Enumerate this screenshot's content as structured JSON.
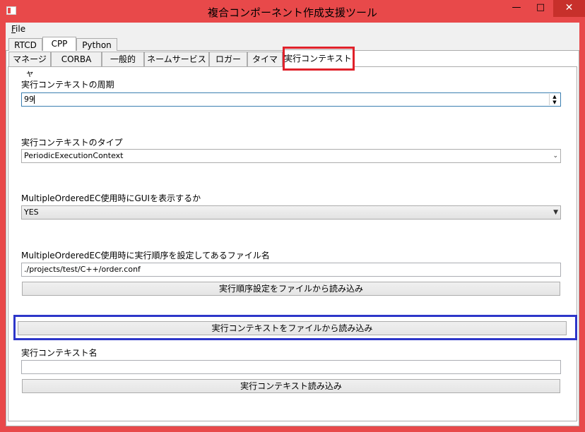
{
  "window": {
    "title": "複合コンポーネント作成支援ツール",
    "minimize_icon": "minimize-icon",
    "maximize_icon": "maximize-icon",
    "close_icon": "close-icon",
    "accent": "#e8494a"
  },
  "menu": {
    "file_prefix": "F",
    "file_rest": "ile"
  },
  "outer_tabs": [
    "RTCD",
    "CPP",
    "Python"
  ],
  "outer_tab_active": "CPP",
  "inner_tabs": [
    "マネージャ",
    "CORBA",
    "一般的",
    "ネームサービス",
    "ロガー",
    "タイマ",
    "実行コンテキスト"
  ],
  "inner_tab_active": "実行コンテキスト",
  "form": {
    "period_label": "実行コンテキストの周期",
    "period_value": "99",
    "type_label": "実行コンテキストのタイプ",
    "type_value": "PeriodicExecutionContext",
    "gui_label": "MultipleOrderedEC使用時にGUIを表示するか",
    "gui_value": "YES",
    "order_file_label": "MultipleOrderedEC使用時に実行順序を設定してあるファイル名",
    "order_file_value": "./projects/test/C++/order.conf",
    "load_order_button": "実行順序設定をファイルから読み込み",
    "load_ec_file_button": "実行コンテキストをファイルから読み込み",
    "ec_name_label": "実行コンテキスト名",
    "ec_name_value": "",
    "load_ec_button": "実行コンテキスト読み込み"
  },
  "highlight_colors": {
    "red": "#e0212a",
    "blue": "#2d36c9"
  }
}
